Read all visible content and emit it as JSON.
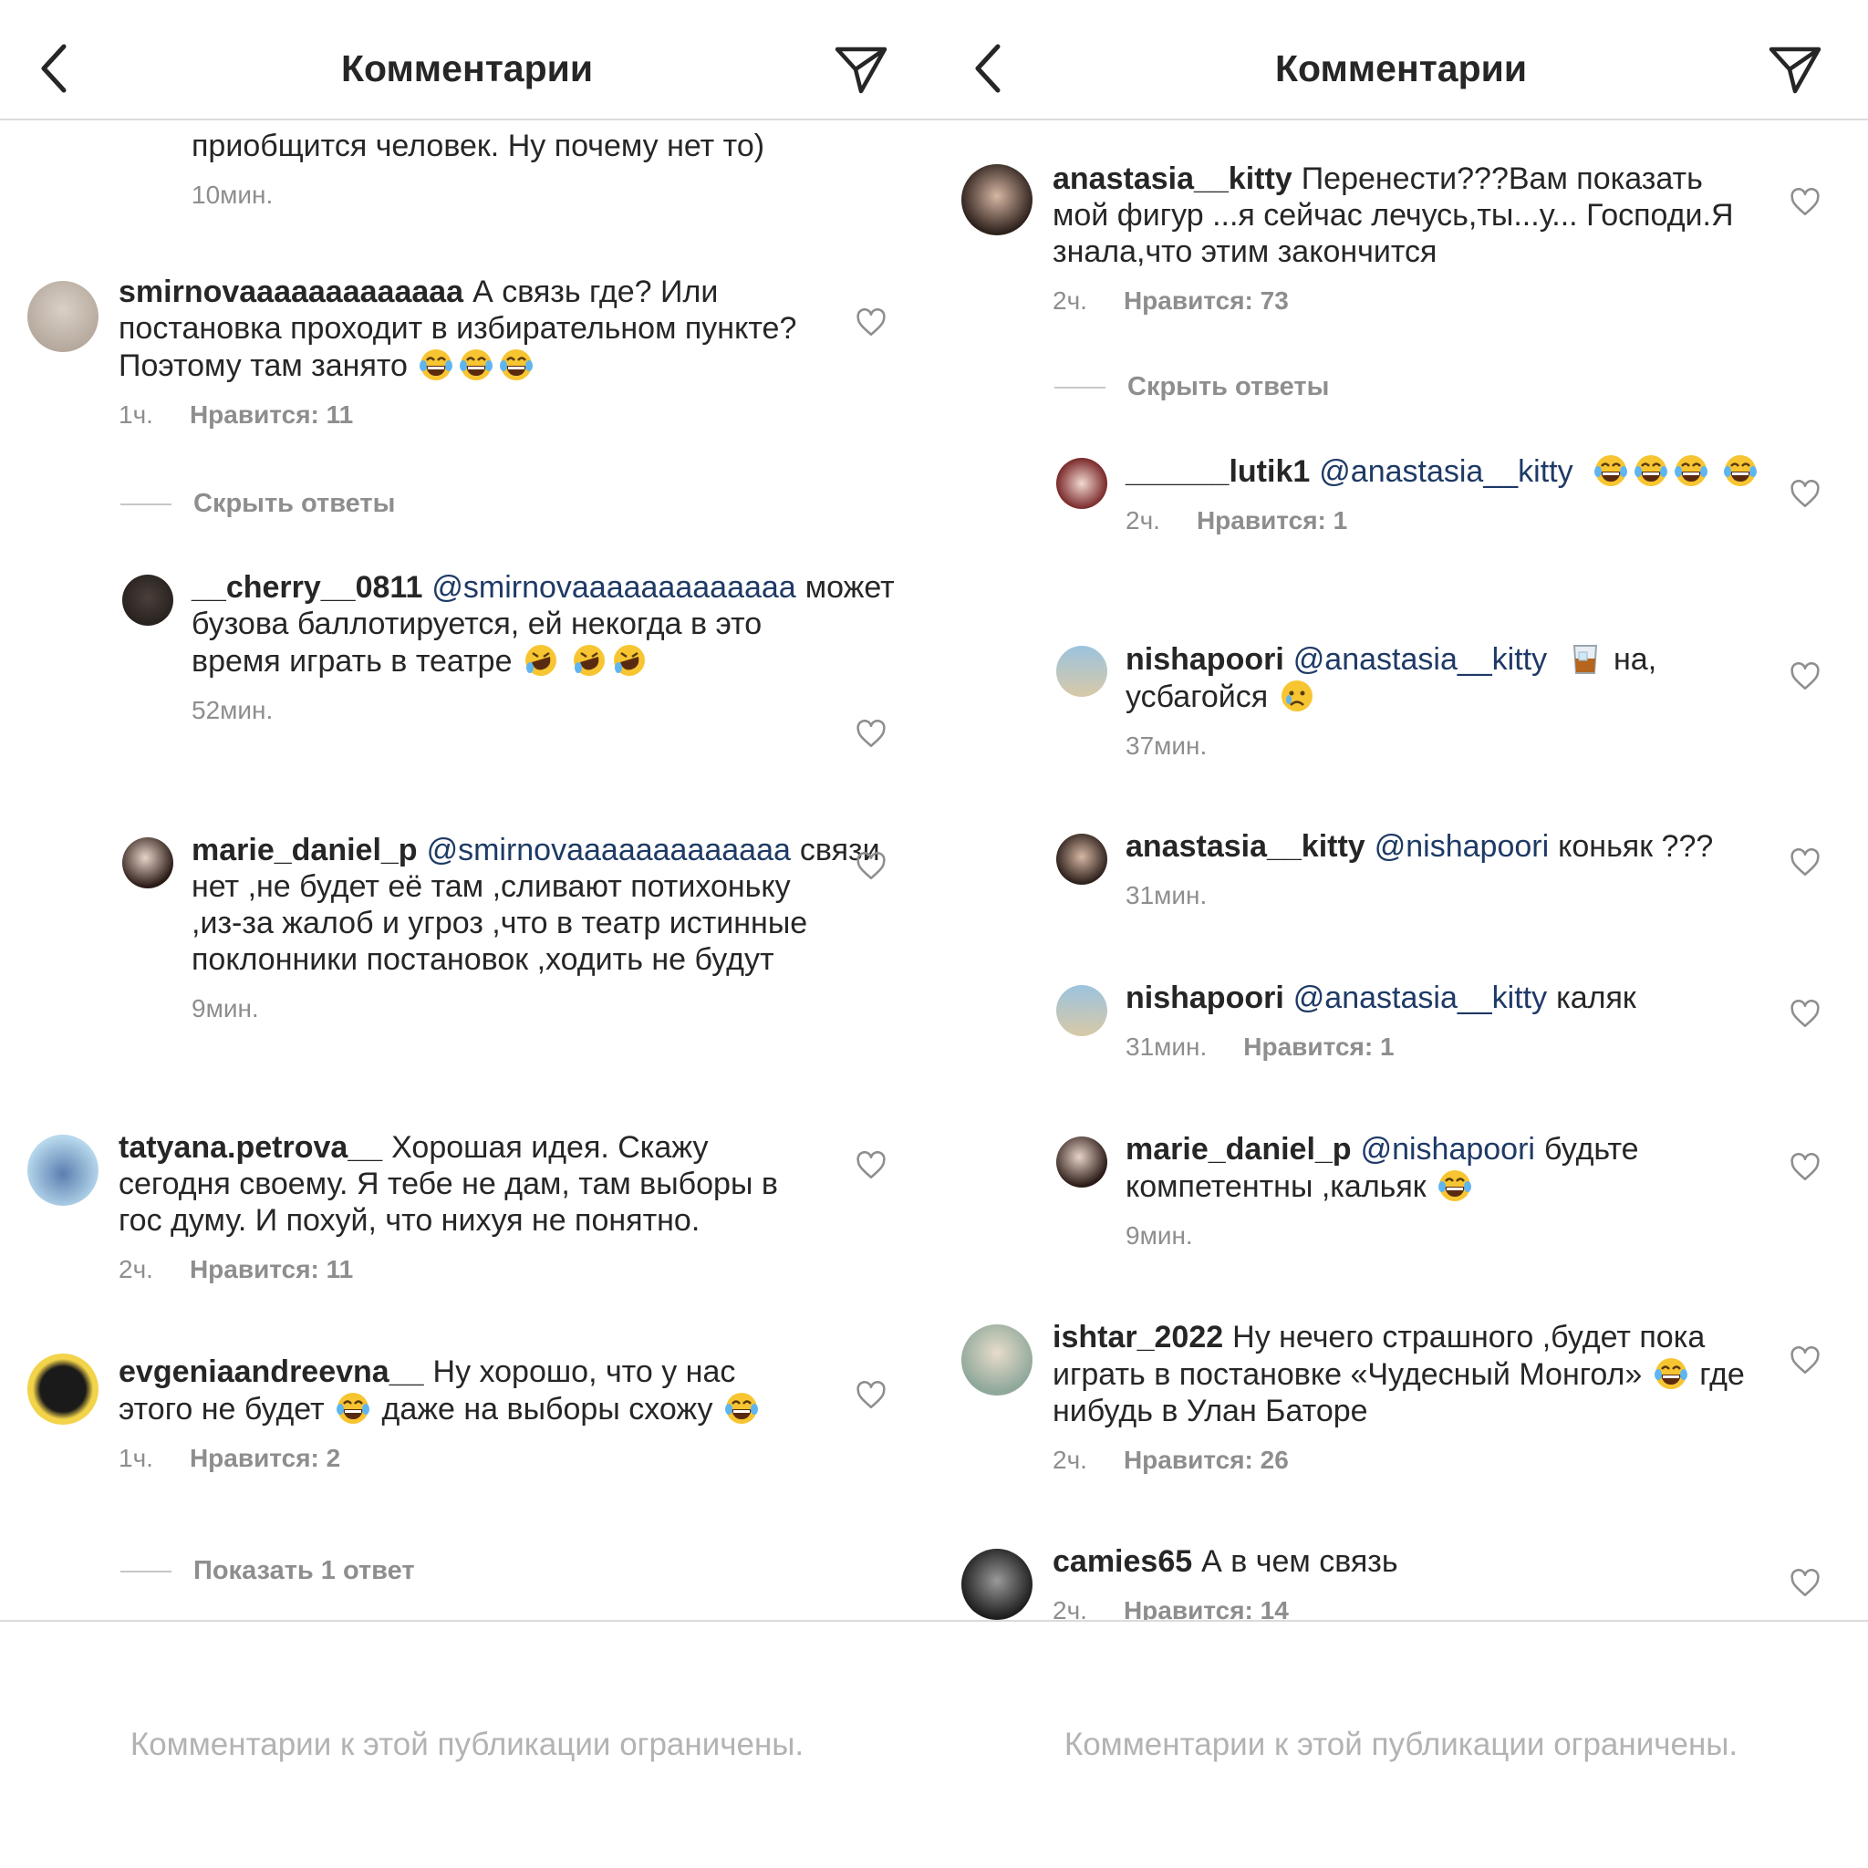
{
  "ui": {
    "title": "Комментарии",
    "footer": "Комментарии к этой публикации ограничены.",
    "hide_replies": "Скрыть ответы",
    "show_one_reply": "Показать 1 ответ"
  },
  "left": {
    "partial": {
      "text": "приобщится человек. Ну почему нет то)",
      "time": "10мин."
    },
    "c1": {
      "user": "smirnovaaaaaaaaaaaaa",
      "text": "А связь где? Или постановка проходит в избирательном пункте? Поэтому там занято",
      "time": "1ч.",
      "likes": "Нравится: 11"
    },
    "r1": {
      "user": "__cherry__0811",
      "mention": "@smirnovaaaaaaaaaaaaa",
      "text": "может бузова баллотируется, ей некогда в это время играть в театре",
      "time": "52мин."
    },
    "r2": {
      "user": "marie_daniel_p",
      "mention": "@smirnovaaaaaaaaaaaaa",
      "text": "связи нет ,не будет её там ,сливают потихоньку ,из-за жалоб и угроз ,что в театр истинные поклонники постановок ,ходить не будут",
      "time": "9мин."
    },
    "c2": {
      "user": "tatyana.petrova__",
      "text": "Хорошая идея. Скажу сегодня своему. Я тебе не дам, там выборы в гос думу. И похуй, что нихуя не понятно.",
      "time": "2ч.",
      "likes": "Нравится: 11"
    },
    "c3": {
      "user": "evgeniaandreevna__",
      "text1": "Ну хорошо, что у нас этого не будет",
      "text2": "даже на выборы схожу",
      "time": "1ч.",
      "likes": "Нравится: 2"
    }
  },
  "right": {
    "c1": {
      "user": "anastasia__kitty",
      "text": "Перенести???Вам показать мой фигур ...я сейчас лечусь,ты...у... Господи.Я знала,что этим закончится",
      "time": "2ч.",
      "likes": "Нравится: 73"
    },
    "r1": {
      "user": "______lutik1",
      "mention": "@anastasia__kitty",
      "time": "2ч.",
      "likes": "Нравится: 1"
    },
    "r2": {
      "user": "nishapoori",
      "mention": "@anastasia__kitty",
      "text1": "на,",
      "text2": "усбагойся",
      "time": "37мин."
    },
    "r3": {
      "user": "anastasia__kitty",
      "mention": "@nishapoori",
      "text": "коньяк ???",
      "time": "31мин."
    },
    "r4": {
      "user": "nishapoori",
      "mention": "@anastasia__kitty",
      "text": "каляк",
      "time": "31мин.",
      "likes": "Нравится: 1"
    },
    "r5": {
      "user": "marie_daniel_p",
      "mention": "@nishapoori",
      "text": "будьте компетентны ,кальяк",
      "time": "9мин."
    },
    "c2": {
      "user": "ishtar_2022",
      "text1": "Ну нечего страшного ,будет пока играть в постановке «Чудесный Монгол»",
      "text2": "где нибудь в Улан Баторе",
      "time": "2ч.",
      "likes": "Нравится: 26"
    },
    "c3": {
      "user": "camies65",
      "text": "А в чем связь",
      "time": "2ч.",
      "likes": "Нравится: 14"
    }
  },
  "colors": {
    "mention": "#1e3a66",
    "secondary": "#8e8e8e",
    "divider": "#dbdbdb",
    "footer_text": "#b3b3b3"
  }
}
